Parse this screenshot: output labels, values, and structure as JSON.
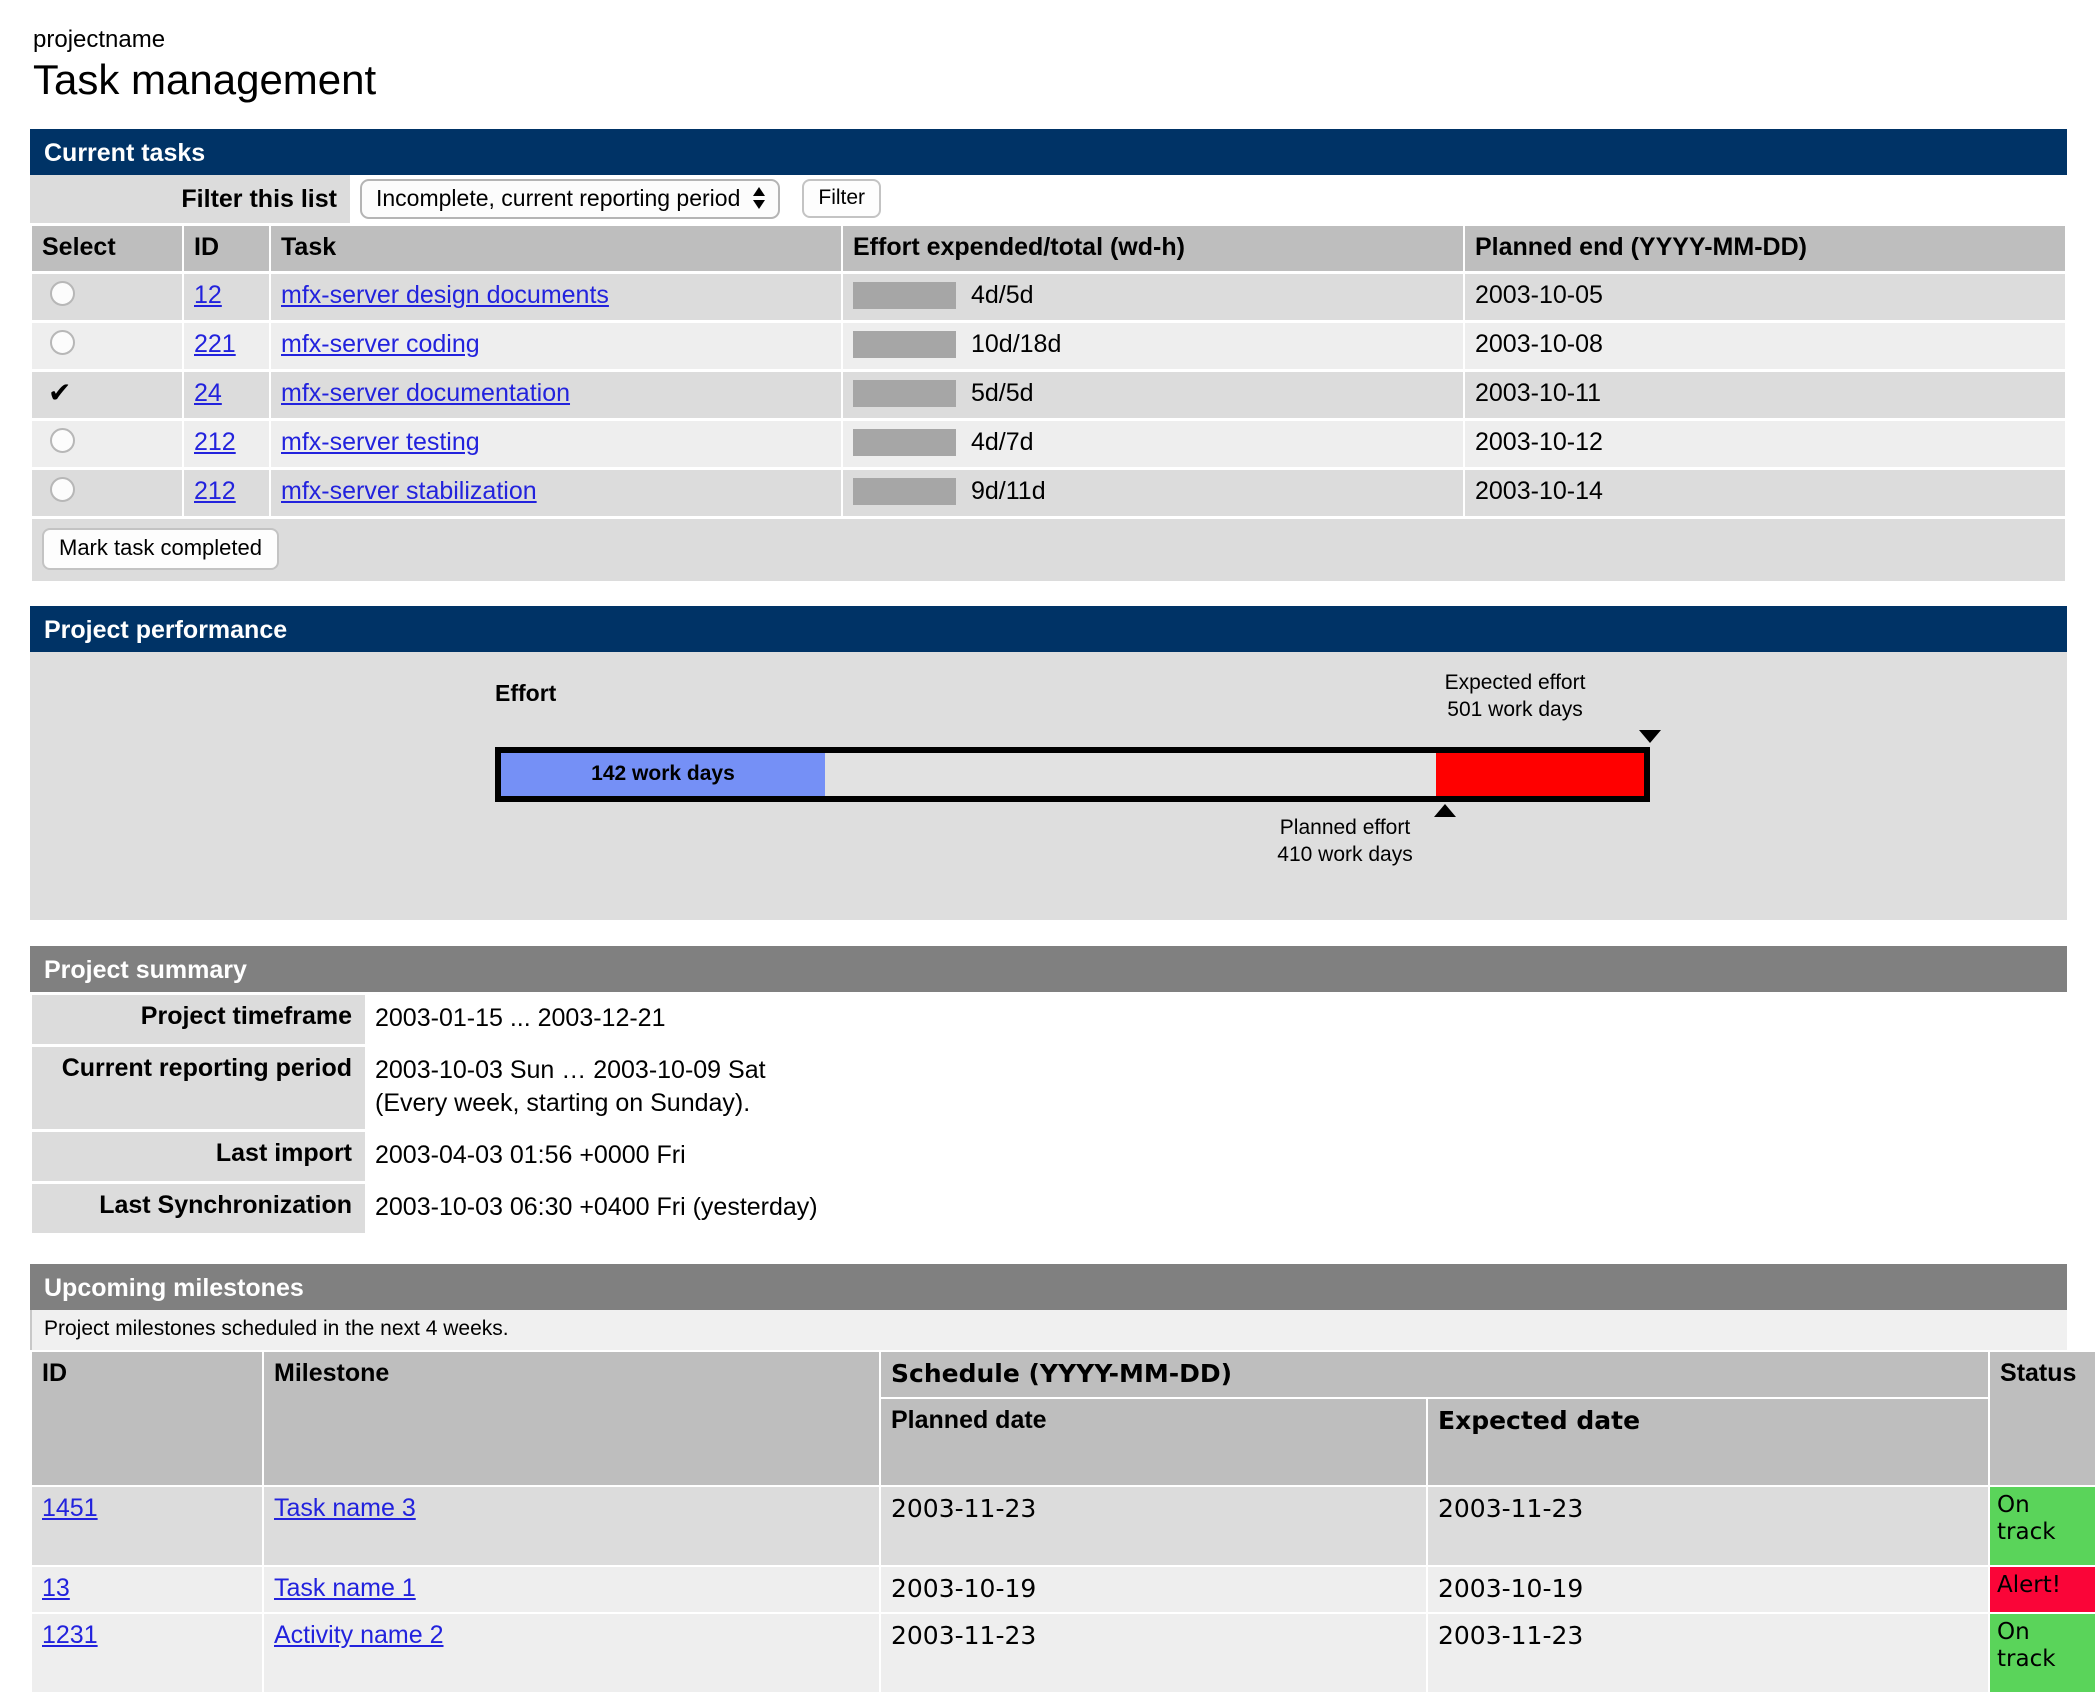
{
  "header": {
    "project_name": "projectname",
    "page_title": "Task management"
  },
  "current_tasks": {
    "panel_title": "Current tasks",
    "filter_label": "Filter this list",
    "filter_selected": "Incomplete, current reporting period",
    "filter_button": "Filter",
    "columns": [
      "Select",
      "ID",
      "Task",
      "Effort expended/total (wd-h)",
      "Planned end (YYYY-MM-DD)"
    ],
    "rows": [
      {
        "selected": false,
        "id": "12",
        "task": "mfx-server design documents",
        "effort": "4d/5d",
        "expended": 4,
        "total": 5,
        "planned_end": "2003-10-05"
      },
      {
        "selected": false,
        "id": "221",
        "task": "mfx-server coding",
        "effort": "10d/18d",
        "expended": 10,
        "total": 18,
        "planned_end": "2003-10-08"
      },
      {
        "selected": true,
        "id": "24",
        "task": "mfx-server documentation",
        "effort": "5d/5d",
        "expended": 5,
        "total": 5,
        "planned_end": "2003-10-11"
      },
      {
        "selected": false,
        "id": "212",
        "task": "mfx-server testing",
        "effort": "4d/7d",
        "expended": 4,
        "total": 7,
        "planned_end": "2003-10-12"
      },
      {
        "selected": false,
        "id": "212",
        "task": "mfx-server stabilization",
        "effort": "9d/11d",
        "expended": 9,
        "total": 11,
        "planned_end": "2003-10-14"
      }
    ],
    "mark_completed_button": "Mark task completed"
  },
  "project_performance": {
    "panel_title": "Project performance"
  },
  "chart_data": {
    "type": "bar",
    "title": "",
    "ylabel": "Effort",
    "xlabel": "",
    "orientation": "horizontal",
    "unit": "work days",
    "axis_label": "Effort",
    "expended_label": "142 work days",
    "expended_value": 142,
    "planned_value": 410,
    "expected_value": 501,
    "xlim": [
      0,
      501
    ],
    "grid": false,
    "annotations": [
      {
        "name": "expected-effort",
        "text": "Expected effort\n501 work days",
        "value": 501,
        "marker": "triangle-down",
        "position": "above-right"
      },
      {
        "name": "planned-effort",
        "text": "Planned effort\n410 work days",
        "value": 410,
        "marker": "triangle-up",
        "position": "below"
      }
    ],
    "segments": [
      {
        "name": "expended",
        "from": 0,
        "to": 142,
        "color": "#7590f6",
        "label": "142 work days"
      },
      {
        "name": "remaining",
        "from": 142,
        "to": 410,
        "color": "#e2e2e2",
        "label": ""
      },
      {
        "name": "overrun",
        "from": 410,
        "to": 501,
        "color": "#ff0000",
        "label": ""
      }
    ]
  },
  "project_summary": {
    "panel_title": "Project summary",
    "rows": [
      {
        "label": "Project timeframe",
        "value": "2003-01-15 ... 2003-12-21"
      },
      {
        "label": "Current reporting period",
        "value": "2003-10-03 Sun … 2003-10-09 Sat\n(Every week, starting on Sunday)."
      },
      {
        "label": "Last import",
        "value": "2003-04-03 01:56 +0000 Fri"
      },
      {
        "label": "Last Synchronization",
        "value": "2003-10-03 06:30 +0400 Fri (yesterday)"
      }
    ]
  },
  "upcoming_milestones": {
    "panel_title": "Upcoming milestones",
    "note": "Project milestones scheduled in the next 4 weeks.",
    "columns": {
      "id": "ID",
      "milestone": "Milestone",
      "schedule": "Schedule (YYYY-MM-DD)",
      "planned_date": "Planned date",
      "expected_date": "Expected date",
      "status": "Status"
    },
    "rows": [
      {
        "id": "1451",
        "milestone": "Task name 3",
        "planned": "2003-11-23",
        "expected": "2003-11-23",
        "status": "On track",
        "status_kind": "ontrack"
      },
      {
        "id": "13",
        "milestone": "Task name 1",
        "planned": "2003-10-19",
        "expected": "2003-10-19",
        "status": "Alert!",
        "status_kind": "alert"
      },
      {
        "id": "1231",
        "milestone": "Activity name 2",
        "planned": "2003-11-23",
        "expected": "2003-11-23",
        "status": "On track",
        "status_kind": "ontrack"
      }
    ]
  },
  "colors": {
    "panel_navy": "#003366",
    "panel_grey": "#808080",
    "bar_blue": "#7590f6",
    "bar_grey": "#a6a6a6",
    "overrun_red": "#ff0000",
    "status_green": "#5ad45a",
    "status_red": "#fa0538",
    "link_blue": "#2222dd"
  }
}
